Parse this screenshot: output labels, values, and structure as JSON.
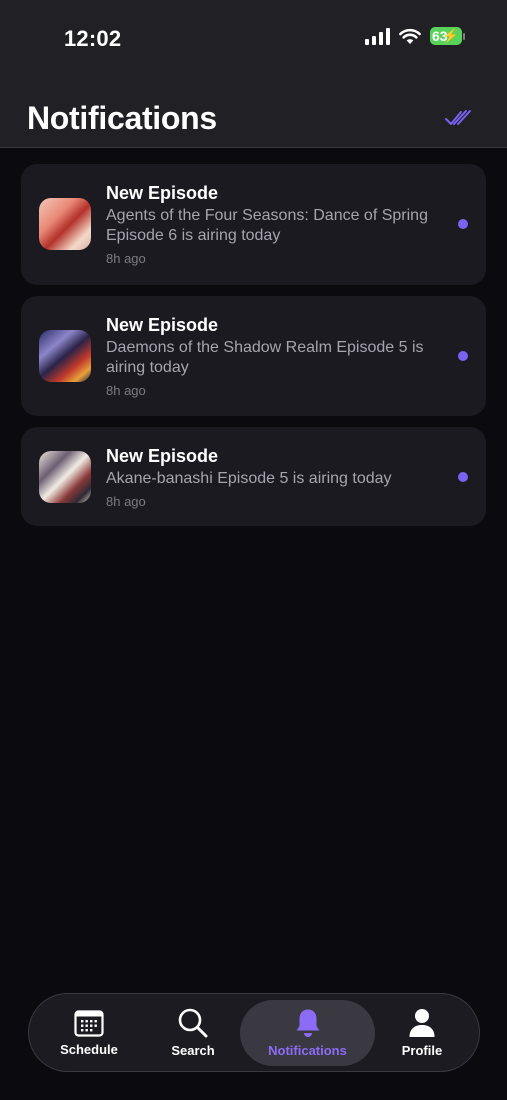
{
  "status_bar": {
    "time": "12:02",
    "battery": "63"
  },
  "header": {
    "title": "Notifications",
    "mark_all_read_icon": "double-check-icon"
  },
  "notifications": [
    {
      "title": "New Episode",
      "body": "Agents of the Four Seasons: Dance of Spring Episode 6 is airing today",
      "time": "8h ago",
      "unread": true
    },
    {
      "title": "New Episode",
      "body": "Daemons of the Shadow Realm Episode 5 is airing today",
      "time": "8h ago",
      "unread": true
    },
    {
      "title": "New Episode",
      "body": "Akane-banashi Episode 5 is airing today",
      "time": "8h ago",
      "unread": true
    }
  ],
  "tabbar": {
    "tabs": [
      {
        "label": "Schedule",
        "icon": "calendar-icon"
      },
      {
        "label": "Search",
        "icon": "search-icon"
      },
      {
        "label": "Notifications",
        "icon": "bell-icon",
        "active": true
      },
      {
        "label": "Profile",
        "icon": "person-icon"
      }
    ]
  },
  "colors": {
    "accent": "#7a63f2",
    "background": "#0b0a0f",
    "card": "#1b1a21",
    "header": "#212025"
  }
}
